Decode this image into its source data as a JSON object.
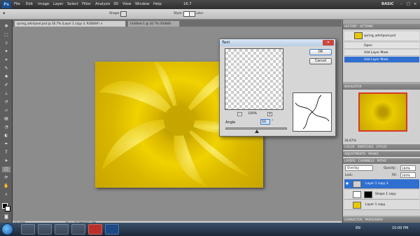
{
  "menubar": {
    "items": [
      "File",
      "Edit",
      "Image",
      "Layer",
      "Select",
      "Filter",
      "Analysis",
      "3D",
      "View",
      "Window",
      "Help"
    ],
    "zoom": "16.7",
    "workspace": "BASIC"
  },
  "options": {
    "shape_label": "Shape:",
    "style_label": "Style:",
    "color_label": "Color:"
  },
  "tabs": [
    {
      "label": "spring_whirlpool.psd @ 16.7% (Layer 1 copy 3, RGB/8#) ×"
    },
    {
      "label": "Untitled-1 @ 16.7% (RGB/8)"
    }
  ],
  "status": {
    "zoom": "16.67%",
    "doc": "Doc: 22.9M/162.3M"
  },
  "dialog": {
    "title": "Twirl",
    "ok": "OK",
    "cancel": "Cancel",
    "zoom": "100%",
    "angle_label": "Angle",
    "angle_value": "50",
    "degree": "°",
    "minus": "−",
    "plus": "+"
  },
  "history": {
    "tab": "HISTORY",
    "tab2": "ACTIONS",
    "snapshot": "spring_whirlpool.psd",
    "items": [
      "Open",
      "Add Layer Mask",
      "Add Layer Mask"
    ]
  },
  "navigator": {
    "tab": "NAVIGATOR",
    "zoom": "16.67%"
  },
  "color": {
    "tabs": [
      "COLOR",
      "SWATCHES",
      "STYLES"
    ]
  },
  "adjust": {
    "tabs": [
      "ADJUSTMENTS",
      "MASKS"
    ]
  },
  "layers": {
    "tabs": [
      "LAYERS",
      "CHANNELS",
      "PATHS"
    ],
    "blend": "Overlay",
    "opacity_label": "Opacity:",
    "opacity": "100%",
    "lock_label": "Lock:",
    "fill_label": "Fill:",
    "fill": "100%",
    "rows": [
      "Layer 1 copy 3",
      "Shape 1 copy",
      "Layer 1 copy"
    ]
  },
  "character": {
    "tabs": [
      "CHARACTER",
      "PARAGRAPH"
    ]
  },
  "taskbar": {
    "lang": "EN",
    "time": "10:00 PM"
  },
  "colors": {
    "accent": "#2f6fd0",
    "image_yellow": "#e8c800",
    "close_red": "#c9463a"
  }
}
